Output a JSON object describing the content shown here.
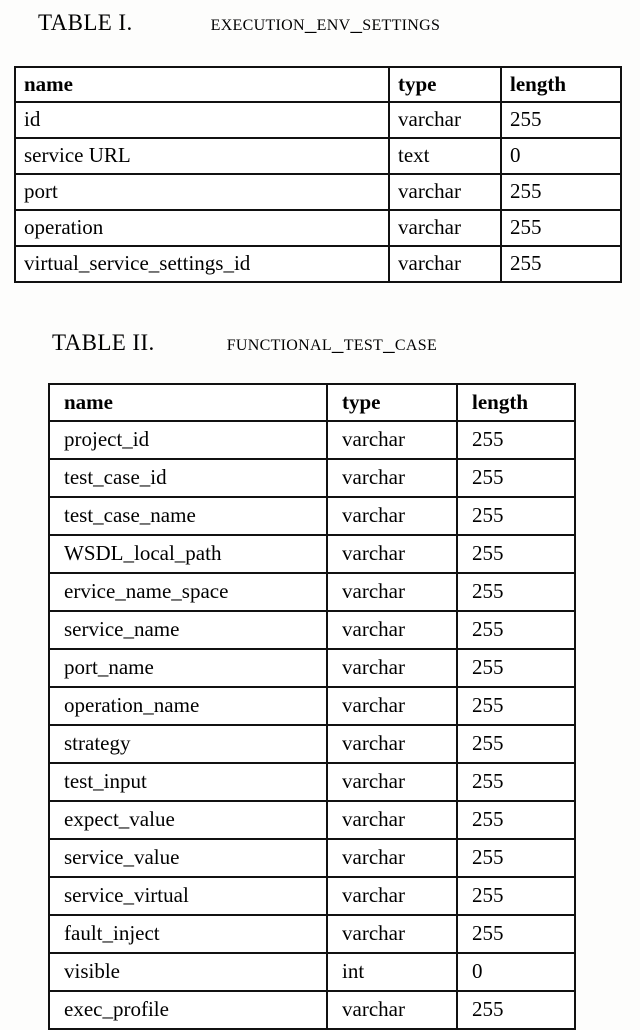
{
  "document": {
    "background_color": "#fdfdfc",
    "text_color": "#000000",
    "border_color": "#111111"
  },
  "tables": [
    {
      "caption_label": "TABLE I.",
      "caption_name": "EXECUTION_ENV_SETTINGS",
      "columns": [
        "name",
        "type",
        "length"
      ],
      "rows": [
        [
          "id",
          "varchar",
          "255"
        ],
        [
          "service URL",
          "text",
          "0"
        ],
        [
          "port",
          "varchar",
          "255"
        ],
        [
          "operation",
          "varchar",
          "255"
        ],
        [
          "virtual_service_settings_id",
          "varchar",
          "255"
        ]
      ]
    },
    {
      "caption_label": "TABLE II.",
      "caption_name": "FUNCTIONAL_TEST_CASE",
      "columns": [
        "name",
        "type",
        "length"
      ],
      "rows": [
        [
          "project_id",
          "varchar",
          "255"
        ],
        [
          "test_case_id",
          "varchar",
          "255"
        ],
        [
          "test_case_name",
          "varchar",
          "255"
        ],
        [
          "WSDL_local_path",
          "varchar",
          "255"
        ],
        [
          "ervice_name_space",
          "varchar",
          "255"
        ],
        [
          "service_name",
          "varchar",
          "255"
        ],
        [
          "port_name",
          "varchar",
          "255"
        ],
        [
          "operation_name",
          "varchar",
          "255"
        ],
        [
          "strategy",
          "varchar",
          "255"
        ],
        [
          "test_input",
          "varchar",
          "255"
        ],
        [
          "expect_value",
          "varchar",
          "255"
        ],
        [
          "service_value",
          "varchar",
          "255"
        ],
        [
          "service_virtual",
          "varchar",
          "255"
        ],
        [
          "fault_inject",
          "varchar",
          "255"
        ],
        [
          "visible",
          "int",
          "0"
        ],
        [
          "exec_profile",
          "varchar",
          "255"
        ]
      ]
    }
  ]
}
